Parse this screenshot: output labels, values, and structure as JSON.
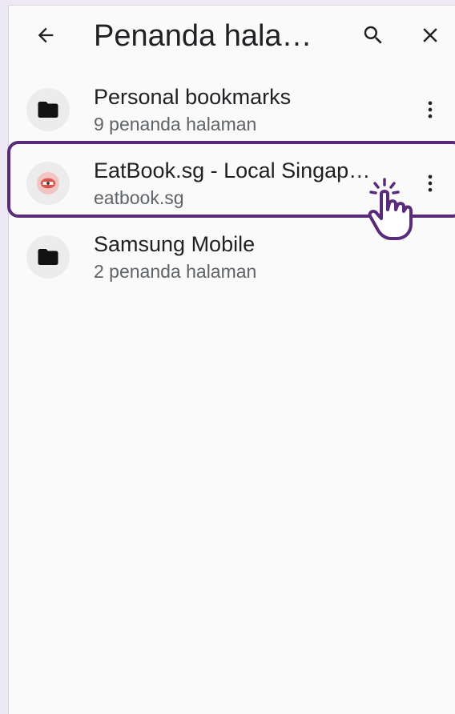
{
  "toolbar": {
    "title": "Penanda hala…",
    "back_icon": "arrow-back-icon",
    "search_icon": "search-icon",
    "close_icon": "close-icon"
  },
  "bookmarks": [
    {
      "title": "Personal bookmarks",
      "subtitle": "9 penanda halaman",
      "icon": "folder-icon"
    },
    {
      "title": "EatBook.sg - Local Singap…",
      "subtitle": "eatbook.sg",
      "icon": "site-favicon-icon"
    },
    {
      "title": "Samsung Mobile",
      "subtitle": "2 penanda halaman",
      "icon": "folder-icon"
    }
  ],
  "colors": {
    "highlight": "#5a2b7a",
    "text_primary": "#202124",
    "text_secondary": "#5f6368",
    "background": "#fafafa"
  }
}
